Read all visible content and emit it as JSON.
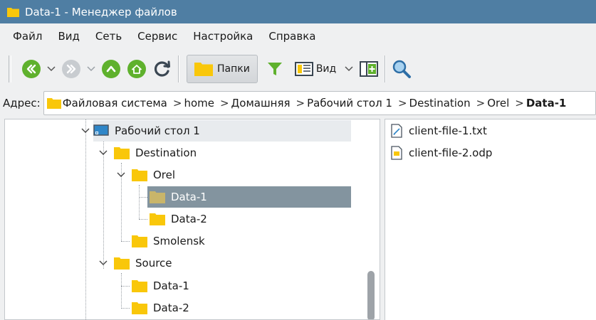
{
  "window": {
    "title": "Data-1 - Менеджер файлов"
  },
  "menu": [
    "Файл",
    "Вид",
    "Сеть",
    "Сервис",
    "Настройка",
    "Справка"
  ],
  "toolbar": {
    "folders_label": "Папки",
    "view_label": "Вид"
  },
  "address": {
    "label": "Адрес:",
    "crumbs": [
      "Файловая система",
      "home",
      "Домашняя",
      "Рабочий стол 1",
      "Destination",
      "Orel",
      "Data-1"
    ]
  },
  "tree": {
    "desktop": "Рабочий стол 1",
    "destination": "Destination",
    "orel": "Orel",
    "orel_data1": "Data-1",
    "orel_data2": "Data-2",
    "smolensk": "Smolensk",
    "source": "Source",
    "source_data1": "Data-1",
    "source_data2": "Data-2"
  },
  "files": [
    "client-file-1.txt",
    "client-file-2.odp"
  ],
  "colors": {
    "titlebar": "#4f7ea3",
    "folder": "#f9c70a",
    "folder_selected": "#c9b56a",
    "green": "#5fb12d",
    "selection": "#83949f"
  }
}
